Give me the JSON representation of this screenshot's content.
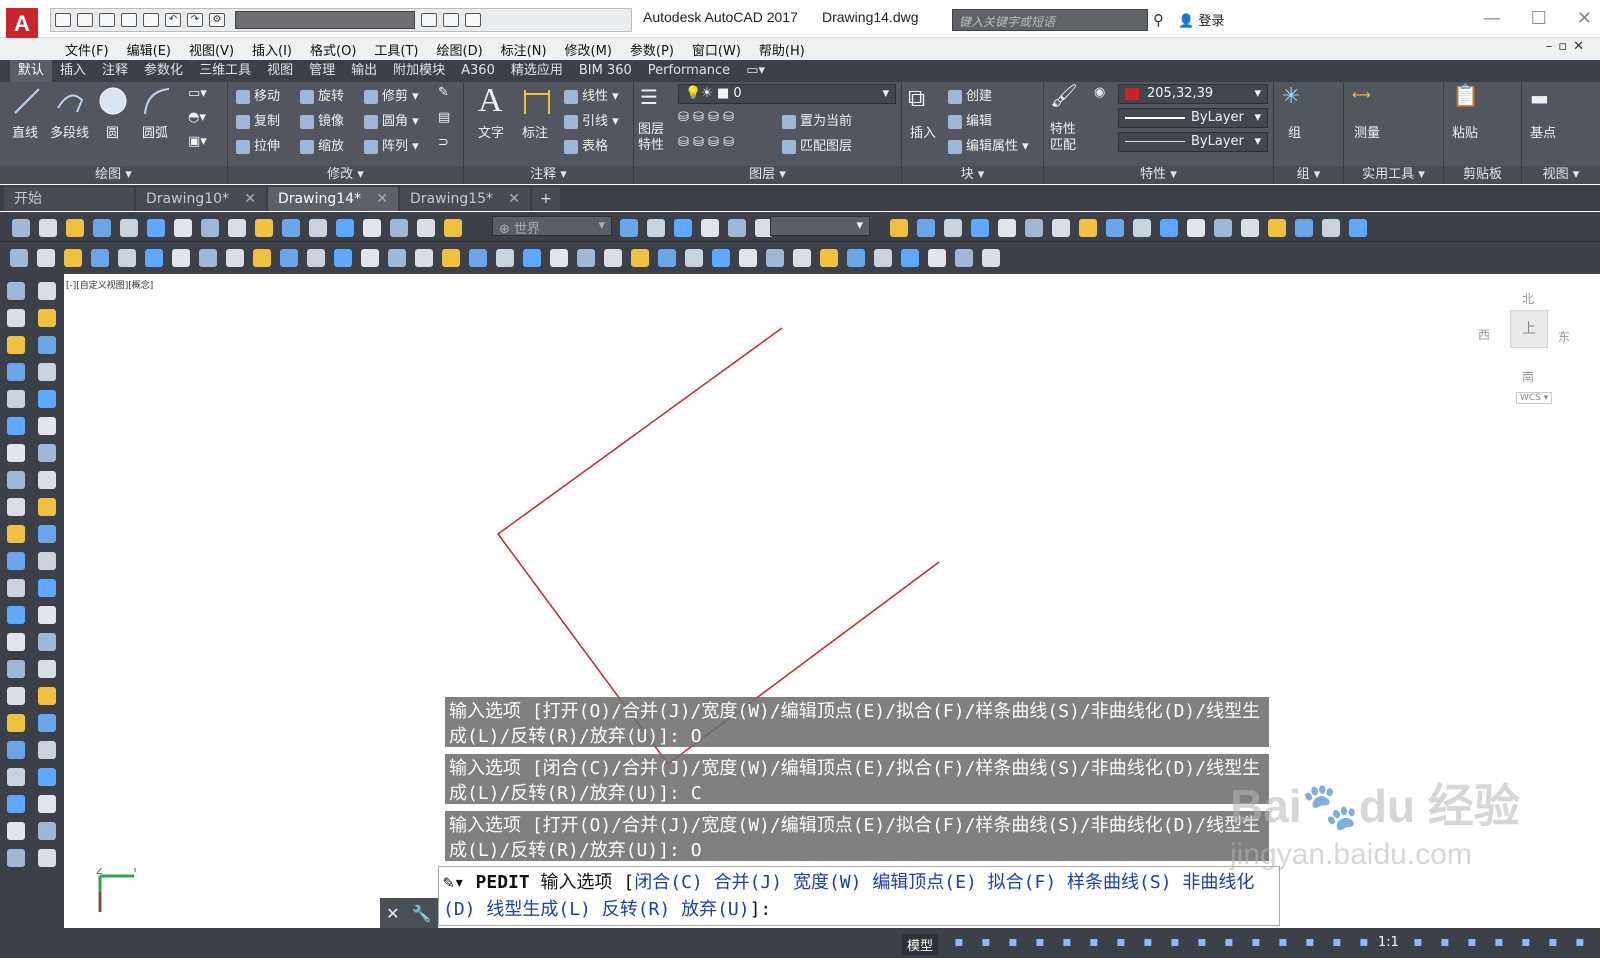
{
  "app": {
    "title": "Autodesk AutoCAD 2017",
    "document": "Drawing14.dwg",
    "search_placeholder": "键入关键字或短语",
    "login": "登录",
    "logo": "A"
  },
  "menu": [
    "文件(F)",
    "编辑(E)",
    "视图(V)",
    "插入(I)",
    "格式(O)",
    "工具(T)",
    "绘图(D)",
    "标注(N)",
    "修改(M)",
    "参数(P)",
    "窗口(W)",
    "帮助(H)"
  ],
  "ribbon_tabs": [
    "默认",
    "插入",
    "注释",
    "参数化",
    "三维工具",
    "视图",
    "管理",
    "输出",
    "附加模块",
    "A360",
    "精选应用",
    "BIM 360",
    "Performance"
  ],
  "ribbon": {
    "draw": {
      "title": "绘图",
      "line": "直线",
      "polyline": "多段线",
      "circle": "圆",
      "arc": "圆弧"
    },
    "modify": {
      "title": "修改",
      "move": "移动",
      "rotate": "旋转",
      "trim": "修剪",
      "copy": "复制",
      "mirror": "镜像",
      "fillet": "圆角",
      "stretch": "拉伸",
      "scale": "缩放",
      "array": "阵列"
    },
    "annotation": {
      "title": "注释",
      "text": "文字",
      "dimension": "标注",
      "linear": "线性",
      "leader": "引线",
      "table": "表格"
    },
    "layers": {
      "title": "图层",
      "props": "图层\n特性",
      "current": "0",
      "set_current": "置为当前",
      "match": "匹配图层"
    },
    "block": {
      "title": "块",
      "insert": "插入",
      "create": "创建",
      "edit": "编辑",
      "edit_attr": "编辑属性"
    },
    "properties": {
      "title": "特性",
      "match": "特性\n匹配",
      "color": "205,32,39",
      "linetype": "ByLayer",
      "lineweight": "ByLayer"
    },
    "groups": {
      "title": "组",
      "group": "组"
    },
    "utilities": {
      "title": "实用工具",
      "measure": "测量"
    },
    "clipboard": {
      "title": "剪贴板",
      "paste": "粘贴"
    },
    "view": {
      "title": "视图",
      "base": "基点"
    }
  },
  "doc_tabs": [
    {
      "label": "开始"
    },
    {
      "label": "Drawing10*"
    },
    {
      "label": "Drawing14*"
    },
    {
      "label": "Drawing15*"
    }
  ],
  "toolbar": {
    "ucs_combo": "世界"
  },
  "viewport": {
    "label": "[-][自定义视图][概念]"
  },
  "viewcube": {
    "top": "上",
    "north": "北",
    "south": "南",
    "east": "东",
    "west": "西",
    "wcs": "WCS"
  },
  "command_history": [
    "输入选项 [打开(O)/合并(J)/宽度(W)/编辑顶点(E)/拟合(F)/样条曲线(S)/非曲线化(D)/线型生成(L)/反转(R)/放弃(U)]: O",
    "输入选项 [闭合(C)/合并(J)/宽度(W)/编辑顶点(E)/拟合(F)/样条曲线(S)/非曲线化(D)/线型生成(L)/反转(R)/放弃(U)]: C",
    "输入选项 [打开(O)/合并(J)/宽度(W)/编辑顶点(E)/拟合(F)/样条曲线(S)/非曲线化(D)/线型生成(L)/反转(R)/放弃(U)]: O"
  ],
  "command_line": {
    "cmd": "PEDIT",
    "prompt": "输入选项 [",
    "opts": [
      "闭合(C)",
      "合并(J)",
      "宽度(W)",
      "编辑顶点(E)",
      "拟合(F)",
      "样条曲线(S)",
      "非曲线化(D)",
      "线型生成(L)",
      "反转(R)",
      "放弃(U)"
    ],
    "end": "]:"
  },
  "status": {
    "model": "模型",
    "scale": "1:1"
  },
  "watermark": {
    "brand": "Bai",
    "brand2": "du",
    "sub": "经验",
    "url": "jingyan.baidu.com"
  },
  "colors": {
    "polyline": "#c8252c",
    "ribbon": "#52565e",
    "accent": "#1a3fb0"
  }
}
